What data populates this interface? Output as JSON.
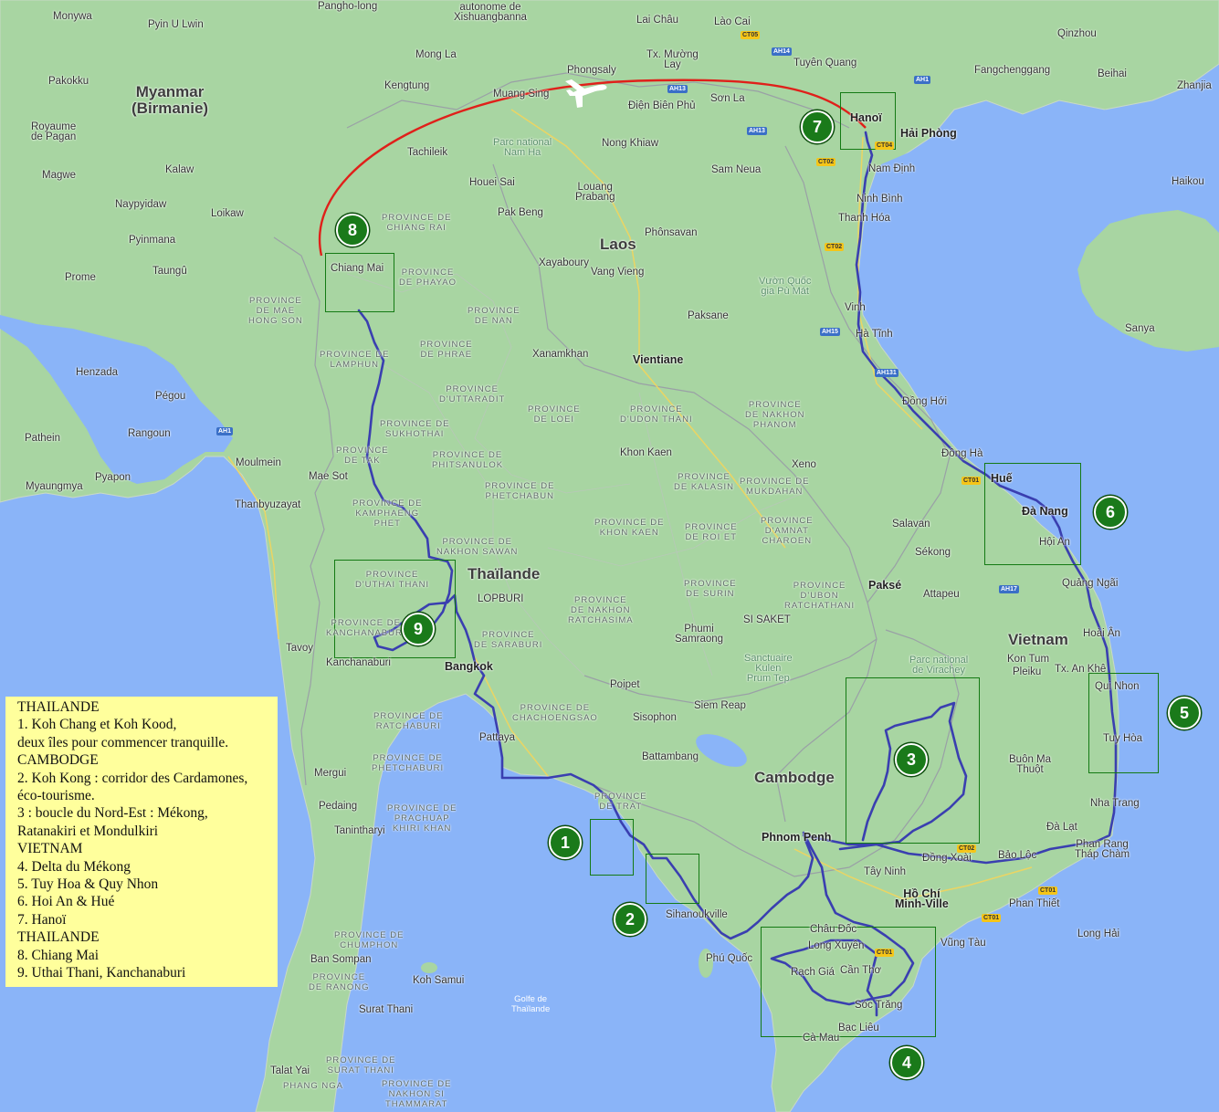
{
  "colors": {
    "sea": "#8ab4f8",
    "land": "#a8d5a2",
    "route": "#3a3fb0",
    "flight": "#e0201a",
    "marker": "#1a7a1a",
    "legend_bg": "#ffff9c"
  },
  "countries": {
    "myanmar": "Myanmar\n(Birmanie)",
    "thailand": "Thaïlande",
    "laos": "Laos",
    "cambodia": "Cambodge",
    "vietnam": "Vietnam"
  },
  "cities": {
    "monywa": "Monywa",
    "pyinulwin": "Pyin U Lwin",
    "panghoLong": "Pangho-long",
    "xishuangbanna": "autonome de\nXishuangbanna",
    "laichau": "Lai Châu",
    "laocai": "Lào Cai",
    "qinzhou": "Qinzhou",
    "pakokku": "Pakokku",
    "monglaMyanmar": "Mong La",
    "txMuongLay": "Tx. Mường\nLay",
    "tuyenquang": "Tuyên Quang",
    "fangchenggang": "Fangchenggang",
    "beihai": "Beihai",
    "zhanjiang": "Zhanjia",
    "royaume": "Royaume\nde Pagan",
    "kengtung": "Kengtung",
    "phongsaly": "Phongsaly",
    "hanoi": "Hanoï",
    "haiphong": "Hải Phòng",
    "muangsing": "Muang Sing",
    "dienbien": "Điện Biên Phủ",
    "sonla": "Sơn La",
    "tachileik": "Tachileik",
    "nongkhiaw": "Nong Khiaw",
    "magwe": "Magwe",
    "kalaw": "Kalaw",
    "houeisai": "Houei Sai",
    "louang": "Louang\nPrabang",
    "samneua": "Sam Neua",
    "namdinh": "Nam Định",
    "haikou": "Haikou",
    "naypyidaw": "Naypyidaw",
    "ninhbinh": "Ninh Bình",
    "loikaw": "Loikaw",
    "pakbeng": "Pak Beng",
    "thanhhoa": "Thanh Hóa",
    "pyinmana": "Pyinmana",
    "phonsavan": "Phônsavan",
    "taungu": "Taungû",
    "xayaboury": "Xayaboury",
    "vangvieng": "Vang Vieng",
    "prome": "Prome",
    "chiangmai": "Chiang Mai",
    "paksane": "Paksane",
    "vinh": "Vinh",
    "sanya": "Sanya",
    "hatinh": "Hà Tĩnh",
    "xanamkhan": "Xanamkhan",
    "henzada": "Henzada",
    "vientiane": "Vientiane",
    "dongnoi": "Đồng Hới",
    "pegou": "Pégou",
    "rangoun": "Rangoun",
    "pathein": "Pathein",
    "khonkaen": "Khon Kaen",
    "xeno": "Xeno",
    "dongha": "Đông Hà",
    "moulmein": "Moulmein",
    "maesot": "Mae Sot",
    "hue": "Huế",
    "pyapon": "Pyapon",
    "danang": "Đà Nang",
    "myaungmya": "Myaungmya",
    "thanbyuzayat": "Thanbyuzayat",
    "salavan": "Salavan",
    "hoian": "Hội An",
    "sekong": "Sékong",
    "pakse": "Paksé",
    "attapeu": "Attapeu",
    "quangngai": "Quảng Ngãi",
    "lopburi": "LOPBURI",
    "phumi": "Phumi\nSamraong",
    "sisaket": "SI SAKET",
    "hoaian": "Hoài Ân",
    "tavoy": "Tavoy",
    "kanchanaburi": "Kanchanaburi",
    "bangkok": "Bangkok",
    "kontum": "Kon Tum",
    "pleiku": "Pleiku",
    "poipet": "Poipet",
    "txankhe": "Tx. An Khê",
    "quinhon": "Qui Nhon",
    "siemreap": "Siem Reap",
    "sisophon": "Sisophon",
    "pattaya": "Pattaya",
    "tuyhoa": "Tuy Hòa",
    "mergui": "Mergui",
    "battambang": "Battambang",
    "buonma": "Buôn Ma\nThuột",
    "pedaing": "Pedaing",
    "nhatrang": "Nha Trang",
    "tanintharyi": "Tanintharyi",
    "phnompenh": "Phnom Penh",
    "dalat": "Đà Lạt",
    "phanrang": "Phan Rang\nTháp Chàm",
    "baoloc": "Bảo Lộc",
    "dongxoai": "Đồng Xoài",
    "tayninh": "Tây Ninh",
    "hochiminh": "Hồ Chí\nMinh-Ville",
    "phanthiet": "Phan Thiết",
    "sihanoukville": "Sihanoukville",
    "chaudoc": "Châu Đốc",
    "longxuyen": "Long Xuyên",
    "vungtau": "Vũng Tàu",
    "phuquoc": "Phú Quốc",
    "rachgia": "Rạch Giá",
    "cantho": "Cần Thơ",
    "longhai": "Long Hải",
    "bansompan": "Ban Sompan",
    "kohsamui": "Koh Samui",
    "soctrang": "Sóc Trăng",
    "baclieu": "Bạc Liêu",
    "camau": "Cà Mau",
    "suratthani": "Surat Thani",
    "talatyai": "Talat Yai"
  },
  "provinces": {
    "chiangrai": "PROVINCE DE\nCHIANG RAI",
    "phayao": "PROVINCE\nDE PHAYAO",
    "maehongson": "PROVINCE\nDE MAE\nHONG SON",
    "nan": "PROVINCE\nDE NAN",
    "lamphun": "PROVINCE DE\nLAMPHUN",
    "phrae": "PROVINCE\nDE PHRAE",
    "uttaradit": "PROVINCE\nD'UTTARADIT",
    "loei": "PROVINCE\nDE LOEI",
    "udonthani": "PROVINCE\nD'UDON THANI",
    "nakhonphanom": "PROVINCE\nDE NAKHON\nPHANOM",
    "sukhothai": "PROVINCE DE\nSUKHOTHAI",
    "tak": "PROVINCE\nDE TAK",
    "phitsanulok": "PROVINCE DE\nPHITSANULOK",
    "kalasin": "PROVINCE\nDE KALASIN",
    "mukdahan": "PROVINCE DE\nMUKDAHAN",
    "phetchabun": "PROVINCE DE\nPHETCHABUN",
    "kamphaeng": "PROVINCE DE\nKAMPHAENG\nPHET",
    "khonkaen": "PROVINCE DE\nKHON KAEN",
    "roiet": "PROVINCE\nDE ROI ET",
    "amnat": "PROVINCE\nD'AMNAT\nCHAROEN",
    "nakhonsawan": "PROVINCE DE\nNAKHON SAWAN",
    "uthaithani": "PROVINCE\nD'UTHAI THANI",
    "surin": "PROVINCE\nDE SURIN",
    "ubon": "PROVINCE\nD'UBON\nRATCHATHANI",
    "nakhonratchasima": "PROVINCE\nDE NAKHON\nRATCHASIMA",
    "kanchanaburi": "PROVINCE DE\nKANCHANABURI",
    "saraburi": "PROVINCE\nDE SARABURI",
    "chachoengsao": "PROVINCE DE\nCHACHOENGSAO",
    "ratchaburi": "PROVINCE DE\nRATCHABURI",
    "phetchaburi": "PROVINCE DE\nPHETCHABURI",
    "trat": "PROVINCE\nDE TRAT",
    "prachuap": "PROVINCE DE\nPRACHUAP\nKHIRI KHAN",
    "chumphon": "PROVINCE DE\nCHUMPHON",
    "ranong": "PROVINCE\nDE RANONG",
    "suratthani": "PROVINCE DE\nSURAT THANI",
    "phangnga": "PHANG NGA",
    "nakhonsi": "PROVINCE DE\nNAKHON SI\nTHAMMARAT"
  },
  "parks": {
    "namha": "Parc national\nNam Ha",
    "vuquoc": "Vườn Quốc\ngia Pù Mát",
    "kulen": "Sanctuaire\nKulen\nPrum Tep",
    "virachey": "Parc national\nde Virachey"
  },
  "sea": {
    "gulf": "Golfe de\nThaïlande"
  },
  "shields": [
    "CT05",
    "AH14",
    "AH1",
    "AH13",
    "AH13",
    "CT04",
    "CT02",
    "CT02",
    "AH15",
    "AH131",
    "CT01",
    "AH17",
    "CT02",
    "CT01",
    "CT01",
    "CT01",
    "AH1"
  ],
  "zones": [
    {
      "id": "1"
    },
    {
      "id": "2"
    },
    {
      "id": "3"
    },
    {
      "id": "4"
    },
    {
      "id": "5"
    },
    {
      "id": "6"
    },
    {
      "id": "7"
    },
    {
      "id": "8"
    },
    {
      "id": "9"
    }
  ],
  "markers": [
    "1",
    "2",
    "3",
    "4",
    "5",
    "6",
    "7",
    "8",
    "9"
  ],
  "legend": [
    "THAILANDE",
    "1. Koh Chang et Koh Kood,",
    "deux îles pour commencer tranquille.",
    "CAMBODGE",
    "2. Koh Kong : corridor des Cardamones,",
    "éco-tourisme.",
    "3 : boucle du Nord-Est : Mékong,",
    "Ratanakiri et Mondulkiri",
    "VIETNAM",
    "4. Delta du Mékong",
    "5. Tuy Hoa & Quy Nhon",
    "6. Hoi An & Hué",
    "7. Hanoï",
    "THAILANDE",
    "8. Chiang Mai",
    "9. Uthai Thani, Kanchanaburi"
  ]
}
